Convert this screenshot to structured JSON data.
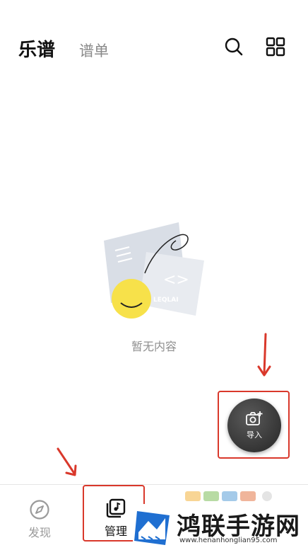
{
  "header": {
    "tabs": [
      {
        "label": "乐谱",
        "active": true
      },
      {
        "label": "谱单",
        "active": false
      }
    ]
  },
  "empty_state": {
    "text": "暂无内容",
    "illustration_brand": "LEQLAI"
  },
  "fab": {
    "label": "导入",
    "icon": "camera-plus-icon"
  },
  "bottom_nav": {
    "items": [
      {
        "label": "发现",
        "icon": "compass-icon",
        "active": false
      },
      {
        "label": "管理",
        "icon": "music-library-icon",
        "active": true
      }
    ]
  },
  "watermark": {
    "title": "鸿联手游网",
    "url": "www.henanhonglian95.com"
  },
  "colors": {
    "highlight": "#d9382b",
    "fab_bg": "#353535",
    "accent_yellow": "#f7e14a"
  }
}
